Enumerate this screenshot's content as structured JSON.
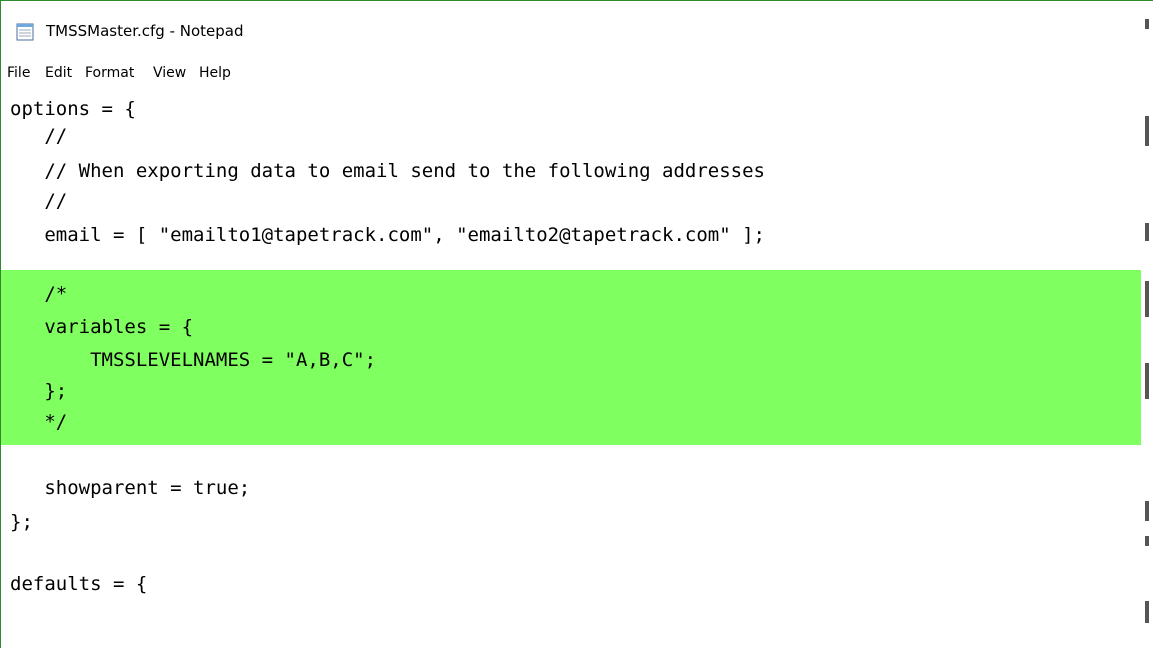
{
  "window": {
    "title": "TMSSMaster.cfg - Notepad",
    "icon": "notepad-icon"
  },
  "menu": {
    "items": [
      "File",
      "Edit",
      "Format",
      "View",
      "Help"
    ]
  },
  "editor": {
    "lines": [
      "options = {",
      "   //",
      "   // When exporting data to email send to the following addresses",
      "   //",
      "   email = [ \"emailto1@tapetrack.com\", \"emailto2@tapetrack.com\" ];",
      "",
      "   /*",
      "   variables = {",
      "       TMSSLEVELNAMES = \"A,B,C\";",
      "   };",
      "   */",
      "",
      "   showparent = true;",
      "};",
      "",
      "defaults = {"
    ],
    "highlight_color": "#80ff60"
  }
}
